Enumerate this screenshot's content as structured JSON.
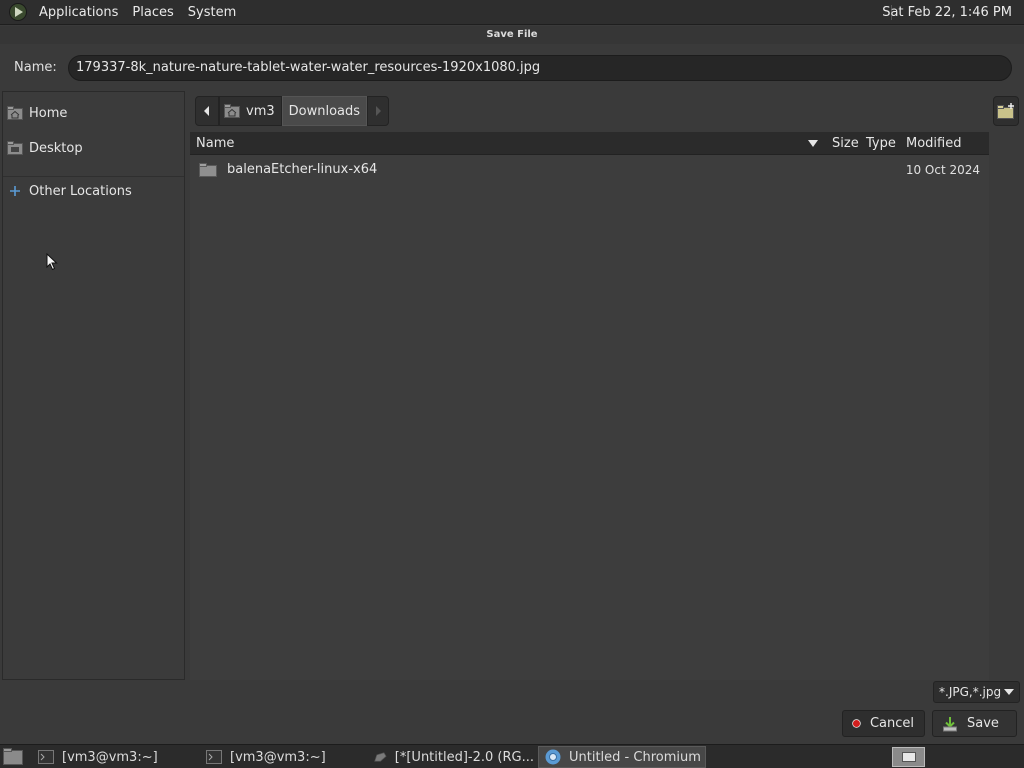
{
  "top_panel": {
    "menus": [
      "Applications",
      "Places",
      "System"
    ],
    "clock": "Sat Feb 22,  1:46 PM"
  },
  "dialog": {
    "title": "Save File",
    "name_label": "Name:",
    "name_value": "179337-8k_nature-nature-tablet-water-water_resources-1920x1080.jpg"
  },
  "sidebar": {
    "items": [
      {
        "label": "Home",
        "icon": "home-folder-icon"
      },
      {
        "label": "Desktop",
        "icon": "desktop-folder-icon"
      },
      {
        "label": "Other Locations",
        "icon": "plus-icon"
      }
    ]
  },
  "pathbar": {
    "segments": [
      "vm3",
      "Downloads"
    ]
  },
  "filelist": {
    "columns": [
      "Name",
      "Size",
      "Type",
      "Modified"
    ],
    "rows": [
      {
        "name": "balenaEtcher-linux-x64",
        "size": "",
        "type": "",
        "modified": "10 Oct 2024",
        "icon": "folder-icon"
      }
    ]
  },
  "footer": {
    "filter": "*.JPG,*.jpg",
    "cancel": "Cancel",
    "save": "Save"
  },
  "taskbar": {
    "tasks": [
      {
        "label": "[vm3@vm3:~]",
        "icon": "terminal-icon"
      },
      {
        "label": "[vm3@vm3:~]",
        "icon": "terminal-icon"
      },
      {
        "label": "[*[Untitled]-2.0 (RG...",
        "icon": "gimp-icon"
      },
      {
        "label": "Untitled - Chromium",
        "icon": "chromium-icon"
      }
    ]
  },
  "colors": {
    "panel_bg": "#2e2e2e",
    "dialog_bg": "#3a3a3a",
    "cancel_red": "#d21e1e",
    "save_green": "#6fbf3a",
    "accent_blue": "#5b9bd5"
  }
}
